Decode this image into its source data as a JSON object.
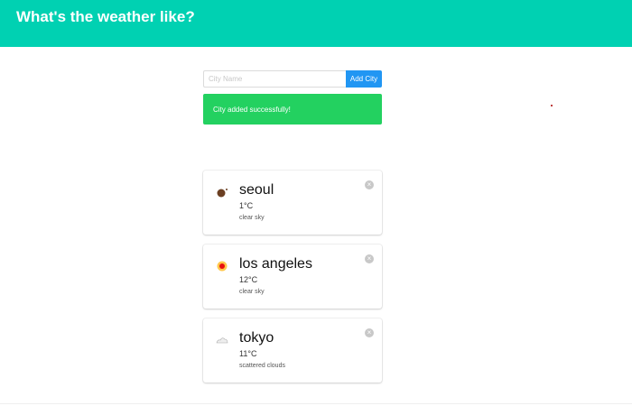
{
  "header": {
    "title": "What's the weather like?"
  },
  "form": {
    "placeholder": "City Name",
    "value": "",
    "button": "Add City"
  },
  "notification": "City added successfully!",
  "cities": [
    {
      "name": "seoul",
      "temp": "1°C",
      "desc": "clear sky",
      "icon": "moon-icon"
    },
    {
      "name": "los angeles",
      "temp": "12°C",
      "desc": "clear sky",
      "icon": "sun-icon"
    },
    {
      "name": "tokyo",
      "temp": "11°C",
      "desc": "scattered clouds",
      "icon": "cloud-icon"
    }
  ],
  "colors": {
    "header": "#00d1b2",
    "button": "#2196f3",
    "success": "#23d160"
  }
}
